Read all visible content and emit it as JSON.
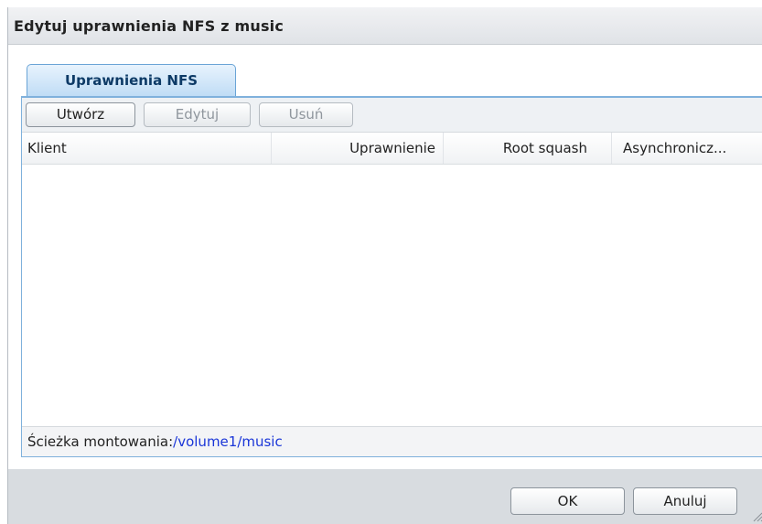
{
  "dialog": {
    "title": "Edytuj uprawnienia NFS z music"
  },
  "tabs": [
    {
      "label": "Uprawnienia NFS",
      "active": true
    }
  ],
  "toolbar": {
    "create_label": "Utwórz",
    "edit_label": "Edytuj",
    "delete_label": "Usuń"
  },
  "grid": {
    "columns": [
      {
        "label": "Klient"
      },
      {
        "label": "Uprawnienie"
      },
      {
        "label": "Root squash"
      },
      {
        "label": "Asynchronicz..."
      }
    ],
    "rows": []
  },
  "footer": {
    "mount_label": "Ścieżka montowania:",
    "mount_path": "/volume1/music"
  },
  "actions": {
    "ok_label": "OK",
    "cancel_label": "Anuluj"
  },
  "colors": {
    "tab_accent": "#6aa4d6",
    "link_blue": "#1a36d8",
    "dialog_bg": "#d8dce0"
  }
}
